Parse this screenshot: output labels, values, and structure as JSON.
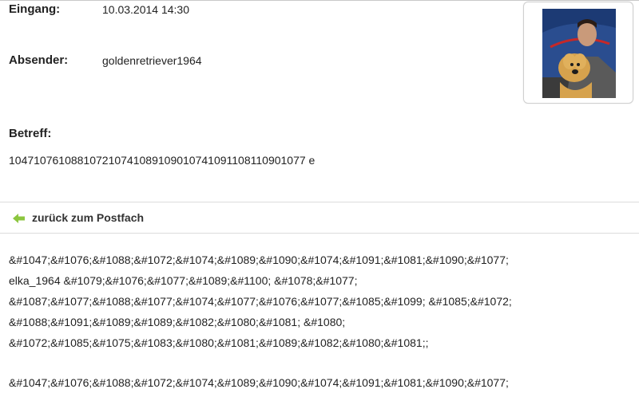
{
  "message": {
    "received_label": "Eingang:",
    "received_value": "10.03.2014 14:30",
    "sender_label": "Absender:",
    "sender_value": "goldenretriever1964",
    "subject_label": "Betreff:",
    "subject_value": "104710761088107210741089109010741091108110901077 e",
    "back_link": "zurück zum Postfach",
    "body_lines": [
      "&#1047;&#1076;&#1088;&#1072;&#1074;&#1089;&#1090;&#1074;&#1091;&#1081;&#1090;&#1077;",
      "elka_1964 &#1079;&#1076;&#1077;&#1089;&#1100; &#1078;&#1077;",
      "&#1087;&#1077;&#1088;&#1077;&#1074;&#1077;&#1076;&#1077;&#1085;&#1099; &#1085;&#1072;",
      "&#1088;&#1091;&#1089;&#1089;&#1082;&#1080;&#1081; &#1080;",
      "&#1072;&#1085;&#1075;&#1083;&#1080;&#1081;&#1089;&#1082;&#1080;&#1081;;",
      "",
      "&#1047;&#1076;&#1088;&#1072;&#1074;&#1089;&#1090;&#1074;&#1091;&#1081;&#1090;&#1077;"
    ]
  },
  "icons": {
    "back": "green-arrow-left-icon"
  },
  "colors": {
    "back_arrow": "#8cc63f"
  }
}
